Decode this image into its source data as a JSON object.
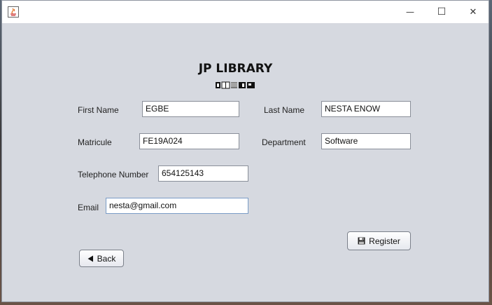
{
  "window": {
    "minimize_glyph": "—",
    "maximize_glyph": "☐",
    "close_glyph": "✕"
  },
  "header": {
    "title": "JP LIBRARY"
  },
  "form": {
    "first_name": {
      "label": "First Name",
      "value": "EGBE"
    },
    "last_name": {
      "label": "Last Name",
      "value": "NESTA ENOW"
    },
    "matricule": {
      "label": "Matricule",
      "value": "FE19A024"
    },
    "department": {
      "label": "Department",
      "value": "Software"
    },
    "telephone": {
      "label": "Telephone Number",
      "value": "654125143"
    },
    "email": {
      "label": "Email",
      "value": "nesta@gmail.com"
    }
  },
  "buttons": {
    "register_label": "Register",
    "back_label": "Back"
  },
  "icons": {
    "app": "java-app-icon",
    "register": "floppy-disk-icon",
    "back": "back-arrow-icon",
    "logo": "library-books-icon"
  }
}
